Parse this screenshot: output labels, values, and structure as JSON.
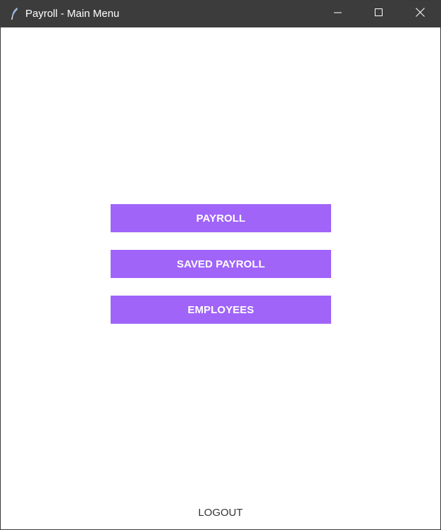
{
  "window": {
    "title": "Payroll - Main Menu",
    "app_icon": "feather-icon"
  },
  "menu": {
    "payroll_label": "PAYROLL",
    "saved_payroll_label": "SAVED PAYROLL",
    "employees_label": "EMPLOYEES",
    "logout_label": "LOGOUT"
  },
  "colors": {
    "titlebar": "#3c3c3c",
    "button": "#a064f9",
    "button_text": "#ffffff",
    "background": "#ffffff"
  }
}
